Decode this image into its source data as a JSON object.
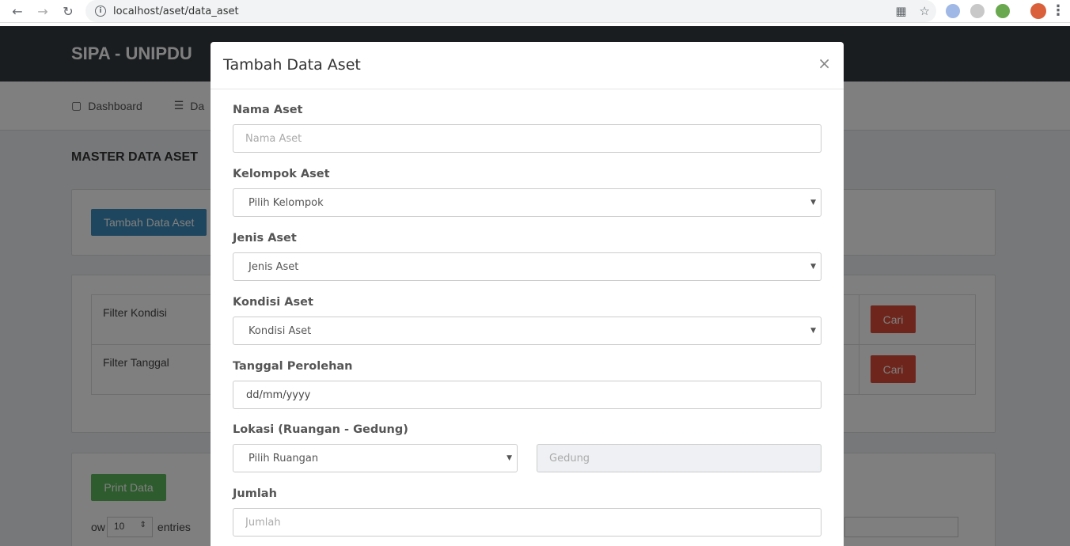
{
  "browser": {
    "url": "localhost/aset/data_aset"
  },
  "header": {
    "brand": "SIPA - UNIPDU"
  },
  "menu": {
    "items": [
      {
        "label": "Dashboard"
      },
      {
        "label": "Da"
      }
    ]
  },
  "page": {
    "title": "MASTER DATA ASET",
    "add_button": "Tambah Data Aset",
    "filters": [
      {
        "label": "Filter Kondisi",
        "button": "Cari"
      },
      {
        "label": "Filter Tanggal",
        "button": "Cari"
      }
    ],
    "print_button": "Print Data",
    "show_prefix": "ow",
    "show_count": "10",
    "show_suffix": "entries"
  },
  "modal": {
    "title": "Tambah Data Aset",
    "close": "×",
    "fields": {
      "nama_label": "Nama Aset",
      "nama_placeholder": "Nama Aset",
      "kelompok_label": "Kelompok Aset",
      "kelompok_value": "Pilih Kelompok",
      "jenis_label": "Jenis Aset",
      "jenis_value": "Jenis Aset",
      "kondisi_label": "Kondisi Aset",
      "kondisi_value": "Kondisi Aset",
      "tanggal_label": "Tanggal Perolehan",
      "tanggal_value": "dd/mm/yyyy",
      "lokasi_label": "Lokasi (Ruangan - Gedung)",
      "ruangan_value": "Pilih Ruangan",
      "gedung_placeholder": "Gedung",
      "jumlah_label": "Jumlah",
      "jumlah_placeholder": "Jumlah"
    }
  }
}
